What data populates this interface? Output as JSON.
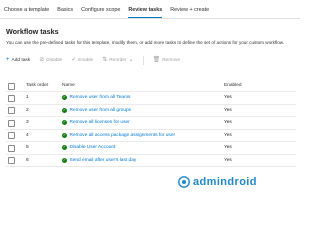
{
  "tabs": [
    {
      "label": "Choose a template",
      "active": false
    },
    {
      "label": "Basics",
      "active": false
    },
    {
      "label": "Configure scope",
      "active": false
    },
    {
      "label": "Review tasks",
      "active": true
    },
    {
      "label": "Review + create",
      "active": false
    }
  ],
  "section": {
    "title": "Workflow tasks",
    "description": "You can use the pre-defined tasks for this template, modify them, or add more tasks to define the set of actions for your custom workflow."
  },
  "toolbar": {
    "add": "Add task",
    "disable": "Disable",
    "enable": "Enable",
    "reorder": "Reorder",
    "remove": "Remove"
  },
  "table": {
    "headers": {
      "order": "Task order",
      "name": "Name",
      "enabled": "Enabled"
    },
    "rows": [
      {
        "order": "1",
        "name": "Remove user from all Teams",
        "enabled": "Yes"
      },
      {
        "order": "2",
        "name": "Remove user from all groups",
        "enabled": "Yes"
      },
      {
        "order": "3",
        "name": "Remove all licenses for user",
        "enabled": "Yes"
      },
      {
        "order": "4",
        "name": "Remove all access package assignments for user",
        "enabled": "Yes"
      },
      {
        "order": "5",
        "name": "Disable User Account",
        "enabled": "Yes"
      },
      {
        "order": "6",
        "name": "Send email after user's last day",
        "enabled": "Yes"
      }
    ]
  },
  "watermark": {
    "text": "admindroid"
  },
  "colors": {
    "accent": "#0078d4",
    "success": "#107c10",
    "watermark": "#1e88c8"
  }
}
